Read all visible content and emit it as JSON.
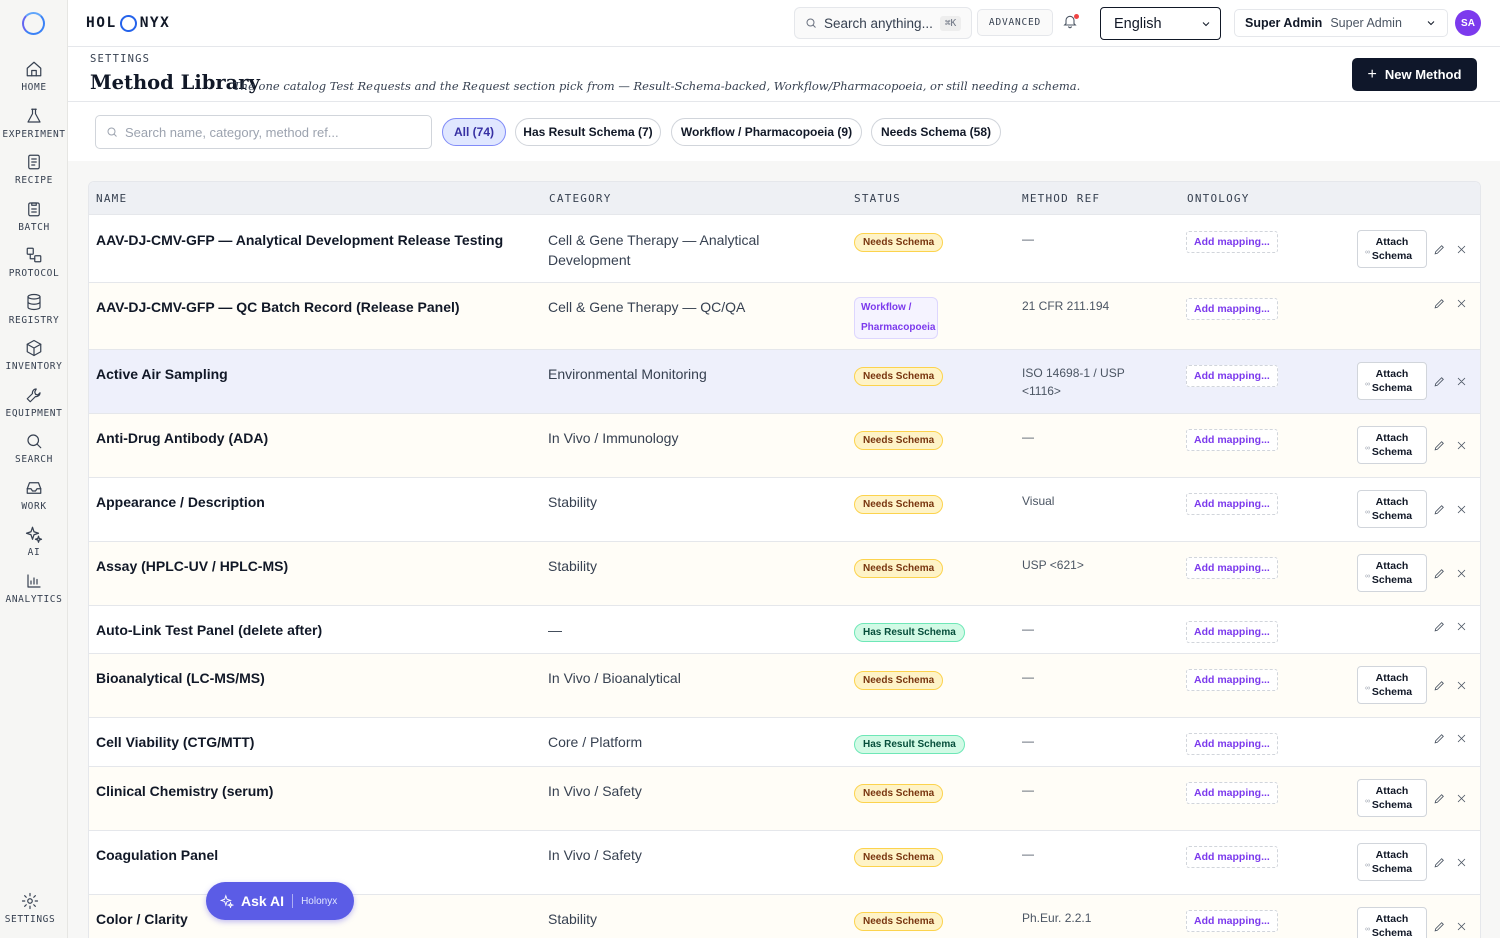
{
  "sidebar": {
    "items": [
      {
        "label": "HOME",
        "icon": "home-icon"
      },
      {
        "label": "EXPERIMENT",
        "icon": "flask-icon"
      },
      {
        "label": "RECIPE",
        "icon": "recipe-icon"
      },
      {
        "label": "BATCH",
        "icon": "clipboard-icon"
      },
      {
        "label": "PROTOCOL",
        "icon": "protocol-icon"
      },
      {
        "label": "REGISTRY",
        "icon": "database-icon"
      },
      {
        "label": "INVENTORY",
        "icon": "box-icon"
      },
      {
        "label": "EQUIPMENT",
        "icon": "wrench-icon"
      },
      {
        "label": "SEARCH",
        "icon": "search-icon"
      },
      {
        "label": "WORK",
        "icon": "inbox-icon"
      },
      {
        "label": "AI",
        "icon": "sparkles-icon"
      },
      {
        "label": "ANALYTICS",
        "icon": "chart-icon"
      }
    ],
    "settings_label": "SETTINGS"
  },
  "topbar": {
    "brand_left": "HOL",
    "brand_right": "NYX",
    "search_placeholder": "Search anything...",
    "search_shortcut": "⌘K",
    "advanced_label": "ADVANCED",
    "language": "English",
    "user_name": "Super Admin",
    "user_role": "Super Admin",
    "avatar_initials": "SA"
  },
  "header": {
    "eyebrow": "SETTINGS",
    "title": "Method Library",
    "subtitle": "The one catalog Test Requests and the Request section pick from — Result-Schema-backed, Workflow/Pharmacopoeia, or still needing a schema.",
    "new_button": "New Method"
  },
  "filters": {
    "search_placeholder": "Search name, category, method ref...",
    "chips": [
      {
        "label": "All (74)",
        "active": true
      },
      {
        "label": "Has Result Schema (7)",
        "active": false
      },
      {
        "label": "Workflow / Pharmacopoeia (9)",
        "active": false
      },
      {
        "label": "Needs Schema (58)",
        "active": false
      }
    ]
  },
  "table": {
    "columns": [
      "NAME",
      "CATEGORY",
      "STATUS",
      "METHOD REF",
      "ONTOLOGY"
    ],
    "add_mapping_label": "Add mapping...",
    "attach_line1": "Attach",
    "attach_line2": "Schema",
    "attach_glyph": "∞",
    "rows": [
      {
        "name": "AAV-DJ-CMV-GFP — Analytical Development Release Testing",
        "category": "Cell & Gene Therapy — Analytical Development",
        "status": "Needs Schema",
        "status_type": "needs",
        "ref": "—",
        "attach": true
      },
      {
        "name": "AAV-DJ-CMV-GFP — QC Batch Record (Release Panel)",
        "category": "Cell & Gene Therapy — QC/QA",
        "status": "Workflow / Pharmacopoeia",
        "status_type": "wf",
        "ref": "21 CFR 211.194",
        "attach": false
      },
      {
        "name": "Active Air Sampling",
        "category": "Environmental Monitoring",
        "status": "Needs Schema",
        "status_type": "needs",
        "ref": "ISO 14698-1 / USP <1116>",
        "attach": true
      },
      {
        "name": "Anti-Drug Antibody (ADA)",
        "category": "In Vivo / Immunology",
        "status": "Needs Schema",
        "status_type": "needs",
        "ref": "—",
        "attach": true
      },
      {
        "name": "Appearance / Description",
        "category": "Stability",
        "status": "Needs Schema",
        "status_type": "needs",
        "ref": "Visual",
        "attach": true
      },
      {
        "name": "Assay (HPLC-UV / HPLC-MS)",
        "category": "Stability",
        "status": "Needs Schema",
        "status_type": "needs",
        "ref": "USP <621>",
        "attach": true
      },
      {
        "name": "Auto-Link Test Panel (delete after)",
        "category": "—",
        "status": "Has Result Schema",
        "status_type": "has",
        "ref": "—",
        "attach": false
      },
      {
        "name": "Bioanalytical (LC-MS/MS)",
        "category": "In Vivo / Bioanalytical",
        "status": "Needs Schema",
        "status_type": "needs",
        "ref": "—",
        "attach": true
      },
      {
        "name": "Cell Viability (CTG/MTT)",
        "category": "Core / Platform",
        "status": "Has Result Schema",
        "status_type": "has",
        "ref": "—",
        "attach": false
      },
      {
        "name": "Clinical Chemistry (serum)",
        "category": "In Vivo / Safety",
        "status": "Needs Schema",
        "status_type": "needs",
        "ref": "—",
        "attach": true
      },
      {
        "name": "Coagulation Panel",
        "category": "In Vivo / Safety",
        "status": "Needs Schema",
        "status_type": "needs",
        "ref": "—",
        "attach": true
      },
      {
        "name": "Color / Clarity",
        "category": "Stability",
        "status": "Needs Schema",
        "status_type": "needs",
        "ref": "Ph.Eur. 2.2.1",
        "attach": true
      }
    ]
  },
  "ask_ai": {
    "label": "Ask AI",
    "sub": "Holonyx"
  }
}
